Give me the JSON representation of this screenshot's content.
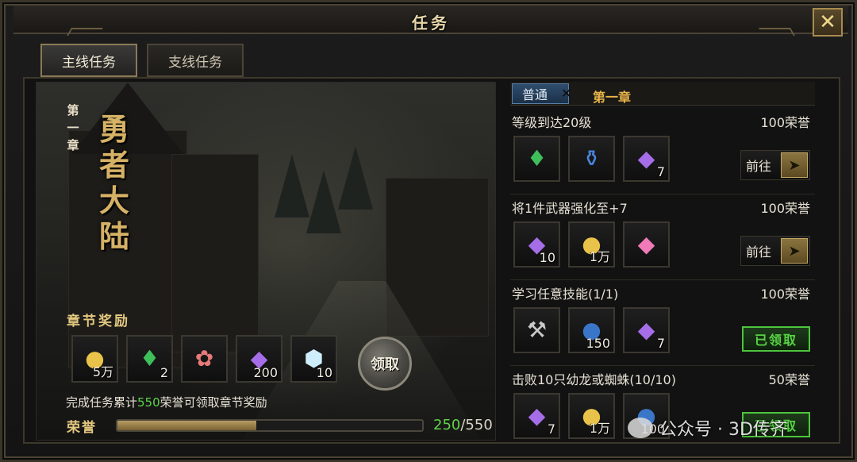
{
  "window": {
    "title": "任务",
    "close_icon": "close-icon"
  },
  "tabs": [
    {
      "label": "主线任务",
      "active": true
    },
    {
      "label": "支线任务",
      "active": false
    }
  ],
  "chapter": {
    "small_chars": [
      "第",
      "一",
      "章"
    ],
    "big_chars": [
      "勇",
      "者",
      "大",
      "陆"
    ]
  },
  "chapter_reward": {
    "title": "章节奖励",
    "items": [
      {
        "icon": "gold-coin-icon",
        "qty": "5万"
      },
      {
        "icon": "green-potion-icon",
        "qty": "2"
      },
      {
        "icon": "pink-creature-icon",
        "qty": ""
      },
      {
        "icon": "purple-gem-icon",
        "qty": "200"
      },
      {
        "icon": "ice-crystal-icon",
        "qty": "10"
      }
    ],
    "claim_label": "领取",
    "progress_prefix": "完成任务累计",
    "progress_value": "550",
    "progress_suffix": "荣誉可领取章节奖励",
    "honor_label": "荣誉",
    "current": "250",
    "max": "/550",
    "fraction": 0.4545
  },
  "chapter_tabs": {
    "normal": "普通",
    "chapter": "第一章"
  },
  "tasks": [
    {
      "name": "等级到达20级",
      "honor": "100荣誉",
      "items": [
        {
          "icon": "green-potion-icon",
          "qty": ""
        },
        {
          "icon": "blue-potion-icon",
          "qty": ""
        },
        {
          "icon": "purple-gem-icon",
          "qty": "7"
        }
      ],
      "action": "前往",
      "action_type": "goto"
    },
    {
      "name": "将1件武器强化至+7",
      "honor": "100荣誉",
      "items": [
        {
          "icon": "purple-gem-icon",
          "qty": "10"
        },
        {
          "icon": "gold-coin-icon",
          "qty": "1万"
        },
        {
          "icon": "pink-gem-icon",
          "qty": ""
        }
      ],
      "action": "前往",
      "action_type": "goto"
    },
    {
      "name": "学习任意技能(1/1)",
      "honor": "100荣誉",
      "items": [
        {
          "icon": "axe-icon",
          "qty": ""
        },
        {
          "icon": "exp-orb-icon",
          "qty": "150"
        },
        {
          "icon": "purple-gem-icon",
          "qty": "7"
        }
      ],
      "action": "已领取",
      "action_type": "claimed"
    },
    {
      "name": "击败10只幼龙或蜘蛛(10/10)",
      "honor": "50荣誉",
      "items": [
        {
          "icon": "purple-gem-icon",
          "qty": "7"
        },
        {
          "icon": "gold-coin-icon",
          "qty": "1万"
        },
        {
          "icon": "exp-orb-icon",
          "qty": "100"
        }
      ],
      "action": "已领取",
      "action_type": "claimed"
    }
  ],
  "watermark": "公众号 · 3D传齐",
  "colors": {
    "gold": "#d6b266",
    "green": "#5fd34a",
    "claimed": "#58d444",
    "tab_blue": "#2f4d6e"
  }
}
